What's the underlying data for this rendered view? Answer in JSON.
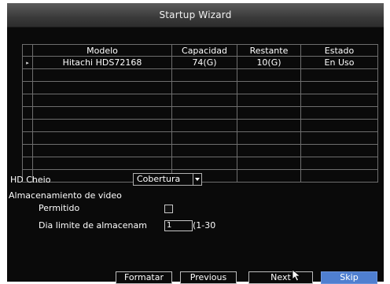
{
  "window": {
    "title": "Startup Wizard"
  },
  "disk_table": {
    "columns": [
      "Modelo",
      "Capacidad",
      "Restante",
      "Estado"
    ],
    "rows": [
      {
        "selected_marker": "▸",
        "model": "Hitachi HDS72168",
        "capacity": "74(G)",
        "remaining": "10(G)",
        "status": "En Uso"
      }
    ]
  },
  "hd_full": {
    "label": "HD Cheio",
    "value": "Cobertura"
  },
  "video_storage": {
    "label": "Almacenamiento de video",
    "permitted_label": "Permitido",
    "limit_label": "Dia limite de almacenam",
    "limit_value": "1",
    "limit_range": "(1-30"
  },
  "buttons": {
    "format": "Formatar",
    "previous": "Previous",
    "next": "Next",
    "skip": "Skip"
  },
  "colors": {
    "background": "#0a0a0a",
    "primary_button": "#4f7fd0"
  }
}
